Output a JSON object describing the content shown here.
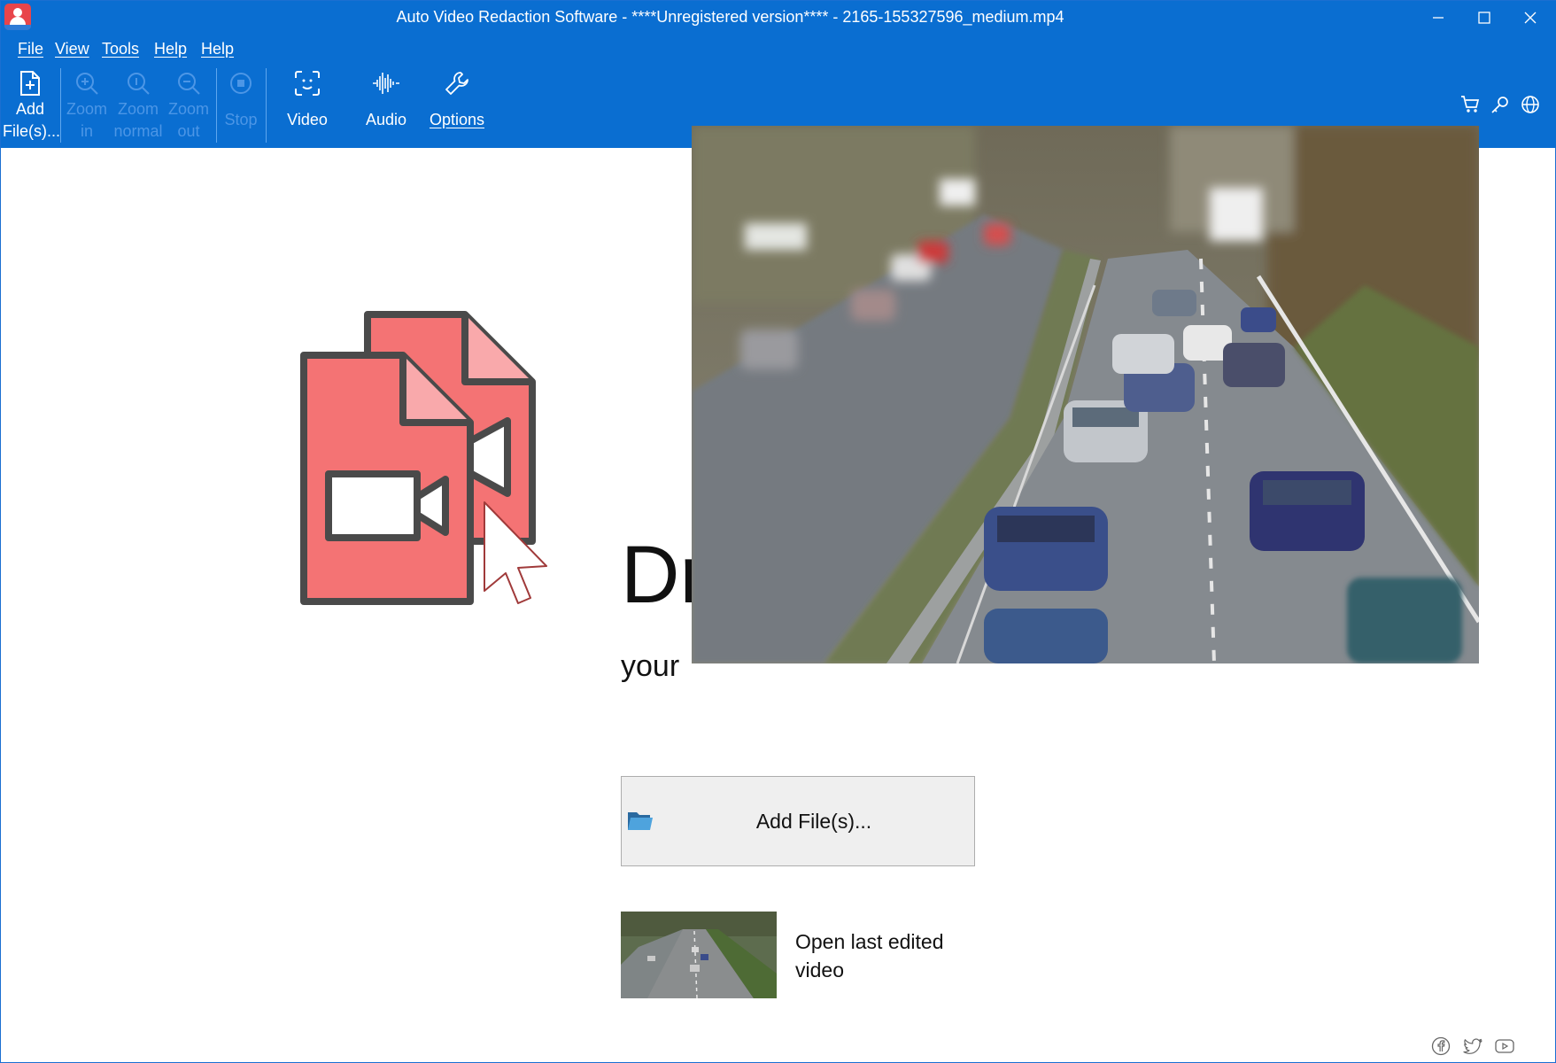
{
  "window": {
    "title": "Auto Video Redaction Software - ****Unregistered version**** - 2165-155327596_medium.mp4",
    "controls": {
      "minimize": "minimize",
      "maximize": "maximize",
      "close": "close"
    }
  },
  "menu": {
    "items": [
      {
        "label": "File"
      },
      {
        "label": "View"
      },
      {
        "label": "Tools"
      },
      {
        "label": "Help"
      },
      {
        "label": "Help"
      }
    ]
  },
  "toolbar": {
    "add_files": {
      "line1": "Add",
      "line2": "File(s)...",
      "icon": "add-file-icon"
    },
    "zoom_in": {
      "line1": "Zoom",
      "line2": "in",
      "icon": "zoom-in-icon",
      "enabled": false
    },
    "zoom_normal": {
      "line1": "Zoom",
      "line2": "normal",
      "icon": "zoom-normal-icon",
      "enabled": false
    },
    "zoom_out": {
      "line1": "Zoom",
      "line2": "out",
      "icon": "zoom-out-icon",
      "enabled": false
    },
    "stop": {
      "label": "Stop",
      "icon": "stop-icon",
      "enabled": false
    },
    "video": {
      "label": "Video",
      "icon": "face-scan-icon"
    },
    "audio": {
      "label": "Audio",
      "icon": "waveform-icon"
    },
    "options": {
      "label": "Options",
      "icon": "wrench-icon"
    },
    "right_icons": [
      "cart-icon",
      "key-icon",
      "globe-icon"
    ]
  },
  "main": {
    "drop_title": "Dr",
    "drop_subtitle": "your",
    "add_button_label": "Add File(s)...",
    "last_edited_label": "Open last edited video"
  },
  "footer": {
    "social_icons": [
      "facebook-icon",
      "twitter-icon",
      "youtube-icon"
    ]
  },
  "colors": {
    "accent": "#0a6ed1",
    "disabled_text": "#4c96e6",
    "illustration_fill": "#f47374",
    "illustration_stroke": "#4a4a4a"
  }
}
